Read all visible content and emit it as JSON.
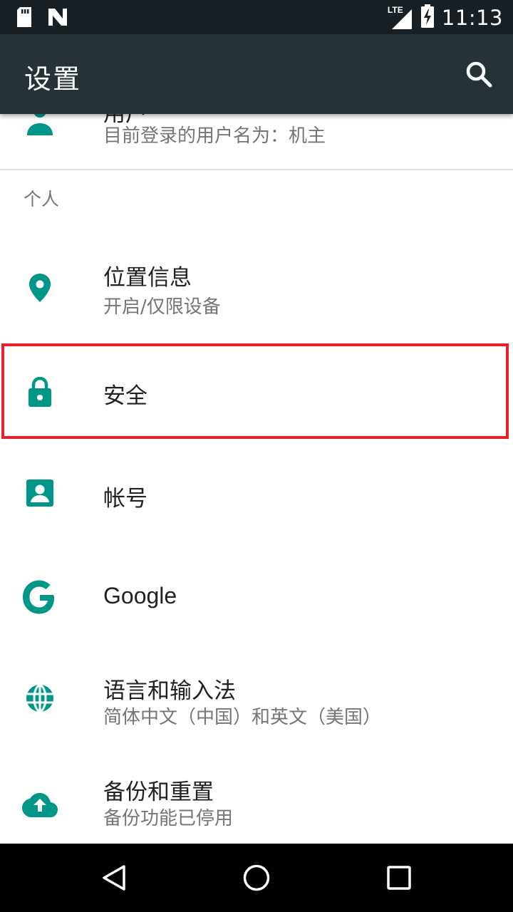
{
  "status_bar": {
    "time": "11:13",
    "network": "LTE",
    "icons": [
      "sd-card-icon",
      "n-notification-icon",
      "lte-signal-icon",
      "battery-charging-icon"
    ]
  },
  "app_bar": {
    "title": "设置",
    "search_icon": "search-icon"
  },
  "colors": {
    "accent": "#009688",
    "app_bar": "#263238",
    "status_bar": "#182025",
    "highlight": "#e8202a"
  },
  "users_row": {
    "title_partial": "用户",
    "subtitle": "目前登录的用户名为：机主",
    "icon": "person-icon"
  },
  "section_personal": {
    "header": "个人",
    "items": [
      {
        "title": "位置信息",
        "subtitle": "开启/仅限设备",
        "icon": "location-pin-icon"
      },
      {
        "title": "安全",
        "subtitle": "",
        "icon": "lock-icon"
      },
      {
        "title": "帐号",
        "subtitle": "",
        "icon": "account-box-icon"
      },
      {
        "title": "Google",
        "subtitle": "",
        "icon": "google-icon"
      },
      {
        "title": "语言和输入法",
        "subtitle": "简体中文（中国）和英文（美国）",
        "icon": "globe-icon"
      },
      {
        "title": "备份和重置",
        "subtitle": "备份功能已停用",
        "icon": "cloud-upload-icon"
      }
    ]
  },
  "nav_bar": {
    "buttons": [
      "back-icon",
      "home-icon",
      "recents-icon"
    ]
  }
}
